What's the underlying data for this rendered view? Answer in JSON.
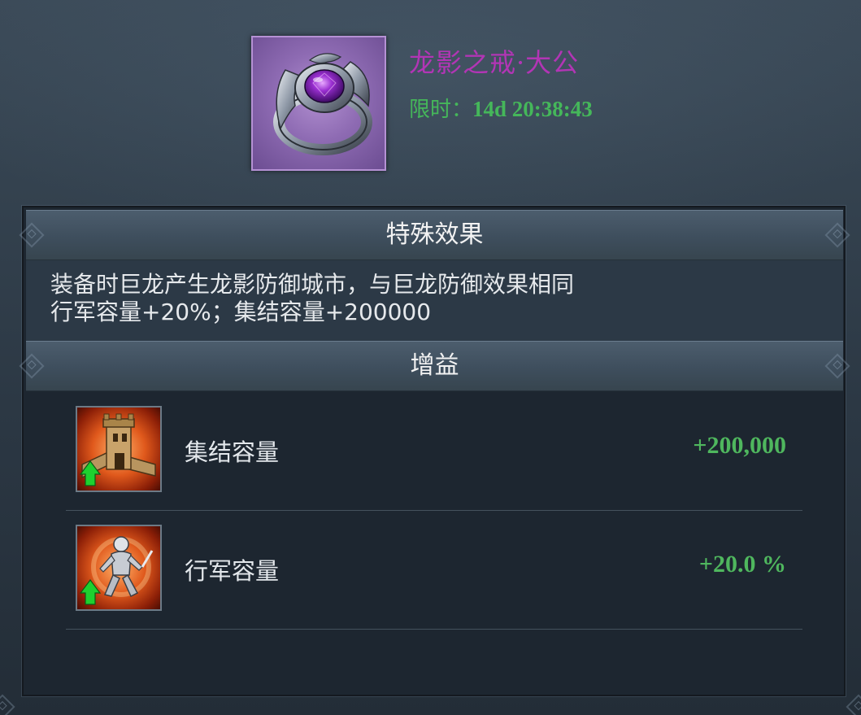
{
  "item": {
    "name": "龙影之戒·大公",
    "timer_label": "限时：",
    "timer_value": "14d 20:38:43",
    "icon": "dragon-ring-icon"
  },
  "special_effect": {
    "header": "特殊效果",
    "lines": [
      "装备时巨龙产生龙影防御城市，与巨龙防御效果相同",
      "行军容量+20%；集结容量+200000"
    ]
  },
  "gain": {
    "header": "增益",
    "rows": [
      {
        "name": "集结容量",
        "value": "+200,000",
        "icon": "rally-capacity-icon"
      },
      {
        "name": "行军容量",
        "value": "+20.0 %",
        "icon": "march-capacity-icon"
      }
    ]
  },
  "colors": {
    "item_name": "#b235b5",
    "timer": "#45b75a",
    "buff_value": "#4fb75e",
    "up_arrow": "#1ed12f"
  }
}
